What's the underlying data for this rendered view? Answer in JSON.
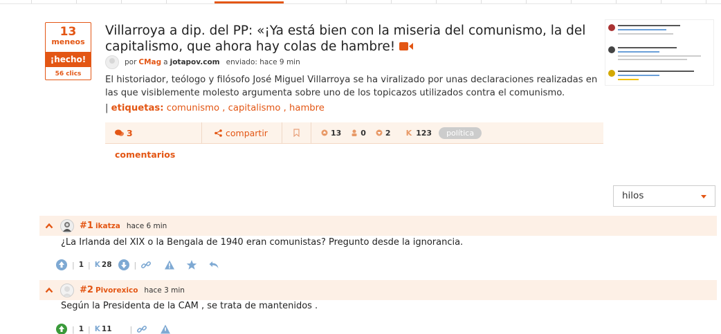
{
  "story": {
    "votes": "13",
    "votes_label": "meneos",
    "voted_label": "¡hecho!",
    "clicks": "56 clics",
    "title": "Villarroya a dip. del PP: «¡Ya está bien con la miseria del comunismo, la del capitalismo, que ahora hay colas de hambre!",
    "meta_por": "por",
    "meta_user": "CMag",
    "meta_a": "a",
    "meta_domain": "jotapov.com",
    "meta_sent": "enviado: hace 9 min",
    "description": "El historiador, teólogo y filósofo José Miguel Villarroya se ha viralizado por unas declaraciones realizadas en las que visiblemente molesto argumenta sobre uno de los topicazos utilizados contra el comunismo.",
    "tags_prefix": "|",
    "tags_label": "etiquetas",
    "tags_colon": ":",
    "tags": [
      "comunismo",
      "capitalismo",
      "hambre"
    ],
    "tag_sep": " ,"
  },
  "actions": {
    "comments": "3 comentarios",
    "share": "compartir",
    "positive": "13",
    "anonymous": "0",
    "negative": "2",
    "karma_label": "K",
    "karma": "123",
    "category": "política"
  },
  "sort": {
    "selected": "hilos"
  },
  "comments": [
    {
      "num": "#1",
      "nick": "ikatza",
      "time": "hace 6 min",
      "text": "¿La Irlanda del XIX o la Bengala de 1940 eran comunistas? Pregunto desde la ignorancia.",
      "votes": "1",
      "karma_label": "K",
      "karma": "28"
    },
    {
      "num": "#2",
      "nick": "Pivorexico",
      "time": "hace 3 min",
      "text": "Según la Presidenta de la CAM , se trata de mantenidos .",
      "votes": "1",
      "karma_label": "K",
      "karma": "11"
    }
  ],
  "colors": {
    "accent": "#e35614",
    "comment_bg": "#fdf0e6",
    "icon_blue": "#7ea9d3",
    "voted_green": "#3a9a3a"
  }
}
